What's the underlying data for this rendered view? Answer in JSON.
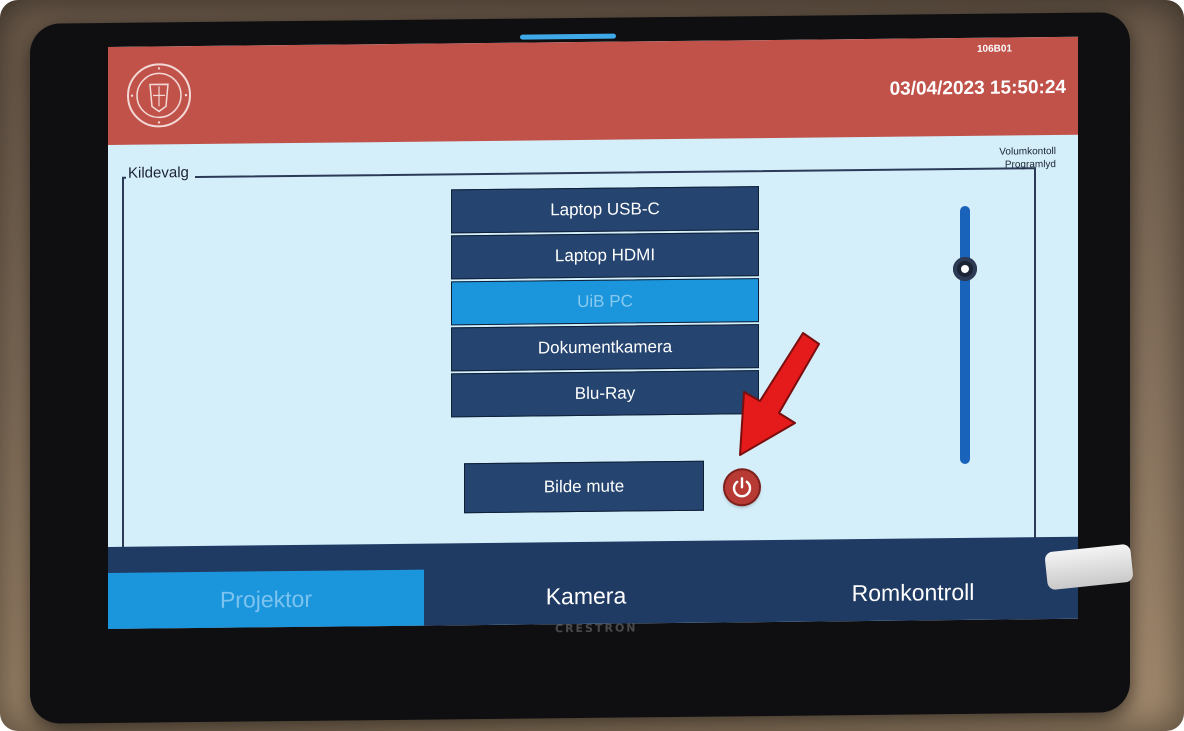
{
  "header": {
    "room_id": "106B01",
    "datetime": "03/04/2023 15:50:24"
  },
  "device_brand": "CRESTRON",
  "source_panel": {
    "title": "Kildevalg",
    "sources": [
      {
        "label": "Laptop USB-C",
        "selected": false
      },
      {
        "label": "Laptop HDMI",
        "selected": false
      },
      {
        "label": "UiB PC",
        "selected": true
      },
      {
        "label": "Dokumentkamera",
        "selected": false
      },
      {
        "label": "Blu-Ray",
        "selected": false
      }
    ],
    "mute_label": "Bilde mute",
    "power_icon": "power-icon"
  },
  "volume": {
    "title_line1": "Volumkontoll",
    "title_line2": "Programlyd",
    "level": 0.78
  },
  "tabs": [
    {
      "label": "Projektor",
      "active": true
    },
    {
      "label": "Kamera",
      "active": false
    },
    {
      "label": "Romkontroll",
      "active": false
    }
  ],
  "colors": {
    "header": "#c0524a",
    "screen_bg": "#d4eefa",
    "button": "#25446f",
    "selected": "#1b96dc",
    "annotation_arrow": "#e51b1b"
  }
}
